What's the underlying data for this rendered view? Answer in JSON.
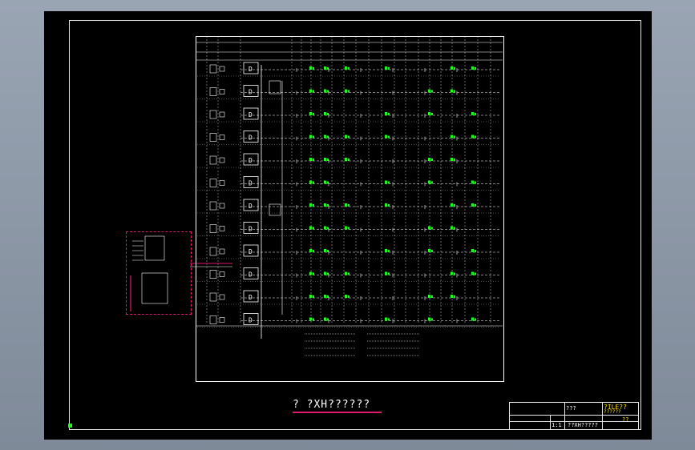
{
  "drawing": {
    "title": "? ?XH??????",
    "background": "#000000",
    "line_color": "#ffffff",
    "accent_green": "#19ff19",
    "accent_magenta": "#e0186c",
    "accent_yellow": "#ffe000"
  },
  "title_block": {
    "company": "?ILE??",
    "company_sub": "??????",
    "code": "???",
    "drawing_name": "??XH?????",
    "scale": "1:1",
    "sheet_mark": "??"
  }
}
